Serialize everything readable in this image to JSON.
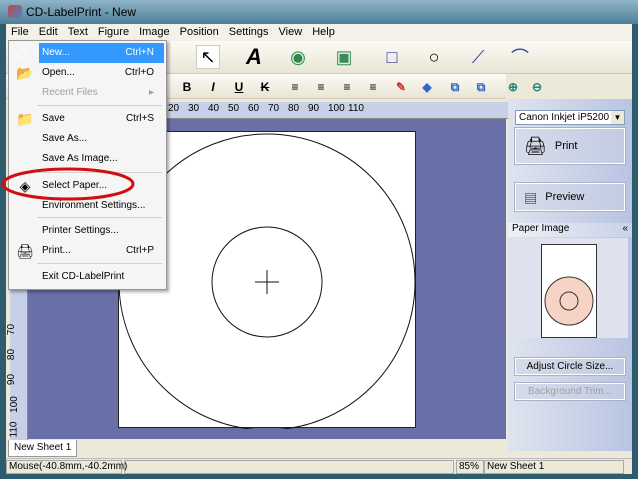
{
  "window": {
    "title": "CD-LabelPrint - New"
  },
  "menubar": [
    "File",
    "Edit",
    "Text",
    "Figure",
    "Image",
    "Position",
    "Settings",
    "View",
    "Help"
  ],
  "file_menu": {
    "items": [
      {
        "label": "New...",
        "shortcut": "Ctrl+N",
        "icon": "new-document-icon",
        "highlighted": true
      },
      {
        "label": "Open...",
        "shortcut": "Ctrl+O",
        "icon": "open-folder-icon"
      },
      {
        "label": "Recent Files",
        "shortcut": "",
        "disabled": true,
        "submenu": true
      },
      {
        "label": "Save",
        "shortcut": "Ctrl+S",
        "icon": "save-folder-icon"
      },
      {
        "label": "Save As...",
        "shortcut": ""
      },
      {
        "label": "Save As Image...",
        "shortcut": ""
      },
      {
        "label": "Select Paper...",
        "shortcut": "",
        "icon": "select-paper-icon",
        "annotated": true
      },
      {
        "label": "Environment Settings...",
        "shortcut": ""
      },
      {
        "label": "Printer Settings...",
        "shortcut": ""
      },
      {
        "label": "Print...",
        "shortcut": "Ctrl+P",
        "icon": "printer-icon"
      },
      {
        "label": "Exit CD-LabelPrint",
        "shortcut": ""
      }
    ],
    "annotation_color": "#d01010"
  },
  "format_toolbar": {
    "bold": "B",
    "italic": "I",
    "underline": "U",
    "strike": "K"
  },
  "ruler": {
    "top_ticks": [
      "20",
      "30",
      "40",
      "50",
      "60",
      "70",
      "80",
      "90",
      "100",
      "110"
    ],
    "left_ticks": [
      "70",
      "80",
      "90",
      "100",
      "110"
    ]
  },
  "right_panel": {
    "printer": "Canon Inkjet iP5200",
    "print_label": "Print",
    "preview_label": "Preview",
    "paper_image_label": "Paper Image",
    "adjust_label": "Adjust Circle Size...",
    "background_label": "Background Trim..."
  },
  "tabs": [
    "New Sheet 1"
  ],
  "status": {
    "mouse": "Mouse(-40.8mm,-40.2mm)",
    "zoom": "85%",
    "sheet": "New Sheet 1"
  },
  "colors": {
    "canvas": "#6970a8",
    "highlight": "#3399ff",
    "disc_preview": "#f7d3c6"
  }
}
